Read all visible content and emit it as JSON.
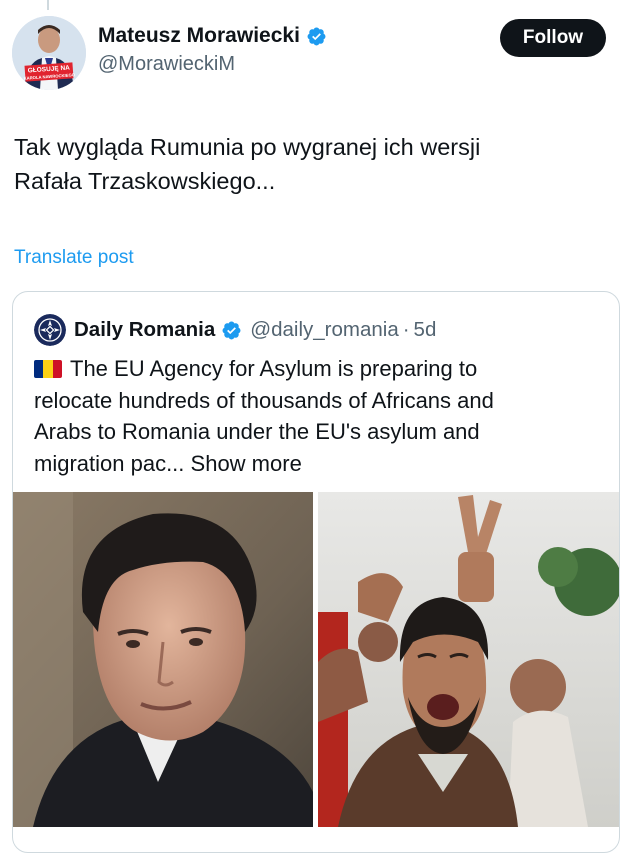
{
  "author": {
    "display_name": "Mateusz Morawiecki",
    "handle": "@MorawieckiM",
    "avatar_badge_line1": "GŁOSUJĘ NA",
    "avatar_badge_line2": "KAROLA NAWROCKIEGO",
    "verified_icon": "verified-badge-icon"
  },
  "follow_button": {
    "label": "Follow"
  },
  "post": {
    "text_line1": "Tak wygląda Rumunia po wygranej ich wersji",
    "text_line2": "Rafała Trzaskowskiego...",
    "translate_label": "Translate post"
  },
  "quote": {
    "display_name": "Daily Romania",
    "handle": "@daily_romania",
    "separator": "·",
    "time": "5d",
    "text_line1": "The EU Agency for Asylum is preparing to",
    "text_line2": "relocate hundreds of thousands of Africans and",
    "text_line3": "Arabs to Romania under the EU's asylum and",
    "text_line4": "migration pac...",
    "show_more": "Show more",
    "flag_colors": [
      "#002b7f",
      "#fcd116",
      "#ce1126"
    ]
  },
  "colors": {
    "accent": "#1d9bf0",
    "text": "#0f1419",
    "muted": "#536471",
    "border": "#cfd9de"
  }
}
